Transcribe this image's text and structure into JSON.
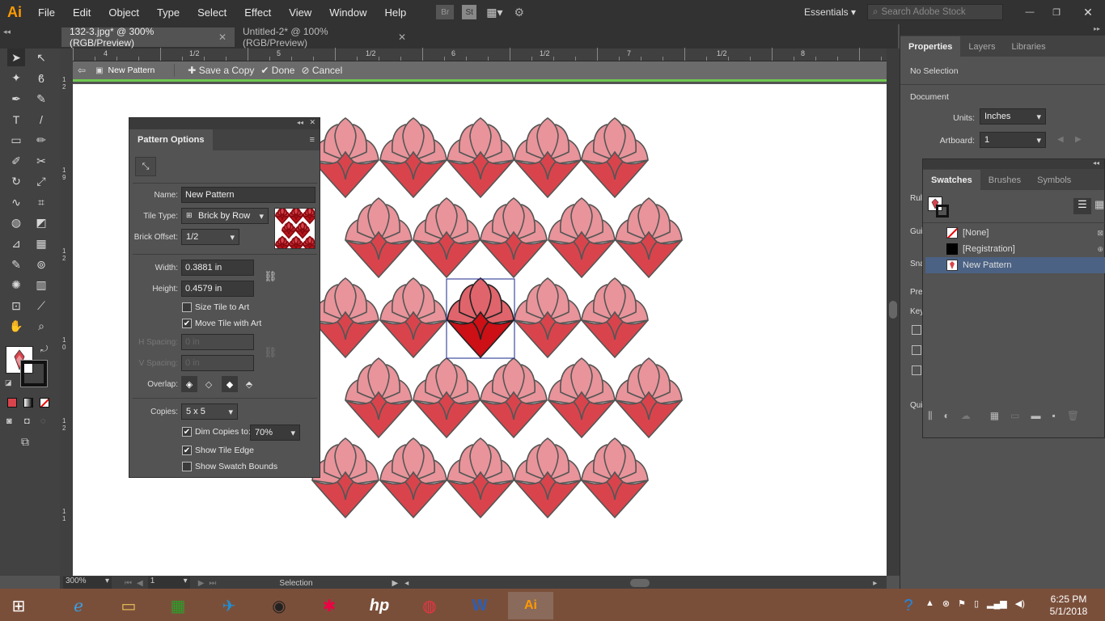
{
  "app": {
    "logo": "Ai",
    "menus": [
      "File",
      "Edit",
      "Object",
      "Type",
      "Select",
      "Effect",
      "View",
      "Window",
      "Help"
    ],
    "workspace": "Essentials",
    "search_placeholder": "Search Adobe Stock",
    "br_label": "Br",
    "st_label": "St"
  },
  "tabs": [
    {
      "label": "132-3.jpg* @ 300% (RGB/Preview)"
    },
    {
      "label": "Untitled-2* @ 100% (RGB/Preview)"
    }
  ],
  "ruler": {
    "top_labels": [
      "4",
      "1/2",
      "5",
      "1/2",
      "6",
      "1/2",
      "7",
      "1/2",
      "8"
    ],
    "left_labels": [
      "1\n2",
      "1\n9",
      "1\n2",
      "1\n0",
      "1\n2",
      "1\n1",
      "1\n2",
      "1\n2"
    ]
  },
  "pattern_bar": {
    "title": "New Pattern",
    "save_copy": "Save a Copy",
    "done": "Done",
    "cancel": "Cancel"
  },
  "pattern_options": {
    "title": "Pattern Options",
    "name_label": "Name:",
    "name_value": "New Pattern",
    "tile_type_label": "Tile Type:",
    "tile_type_value": "Brick by Row",
    "brick_offset_label": "Brick Offset:",
    "brick_offset_value": "1/2",
    "width_label": "Width:",
    "width_value": "0.3881 in",
    "height_label": "Height:",
    "height_value": "0.4579 in",
    "size_tile_label": "Size Tile to Art",
    "size_tile_checked": false,
    "move_tile_label": "Move Tile with Art",
    "move_tile_checked": true,
    "hspacing_label": "H Spacing:",
    "hspacing_value": "0 in",
    "vspacing_label": "V Spacing:",
    "vspacing_value": "0 in",
    "overlap_label": "Overlap:",
    "copies_label": "Copies:",
    "copies_value": "5 x 5",
    "dim_label": "Dim Copies to:",
    "dim_checked": true,
    "dim_value": "70%",
    "show_tile_edge_label": "Show Tile Edge",
    "show_tile_edge_checked": true,
    "show_swatch_bounds_label": "Show Swatch Bounds",
    "show_swatch_bounds_checked": false
  },
  "properties": {
    "tabs": [
      "Properties",
      "Layers",
      "Libraries"
    ],
    "no_selection": "No Selection",
    "document_label": "Document",
    "units_label": "Units:",
    "units_value": "Inches",
    "artboard_label": "Artboard:",
    "artboard_value": "1",
    "partial_labels": [
      "Rul",
      "Gui",
      "Sna",
      "Pre",
      "Key",
      "Qui"
    ]
  },
  "swatches": {
    "tabs": [
      "Swatches",
      "Brushes",
      "Symbols"
    ],
    "items": [
      {
        "label": "[None]"
      },
      {
        "label": "[Registration]"
      },
      {
        "label": "New Pattern"
      }
    ]
  },
  "status": {
    "zoom": "300%",
    "artboard": "1",
    "tool": "Selection"
  },
  "taskbar": {
    "time": "6:25 PM",
    "date": "5/1/2018"
  },
  "colors": {
    "petal_light": "#e8949a",
    "petal_dark": "#d9444c",
    "accent_green": "#6fc84f",
    "selection_blue": "#4b6284"
  }
}
